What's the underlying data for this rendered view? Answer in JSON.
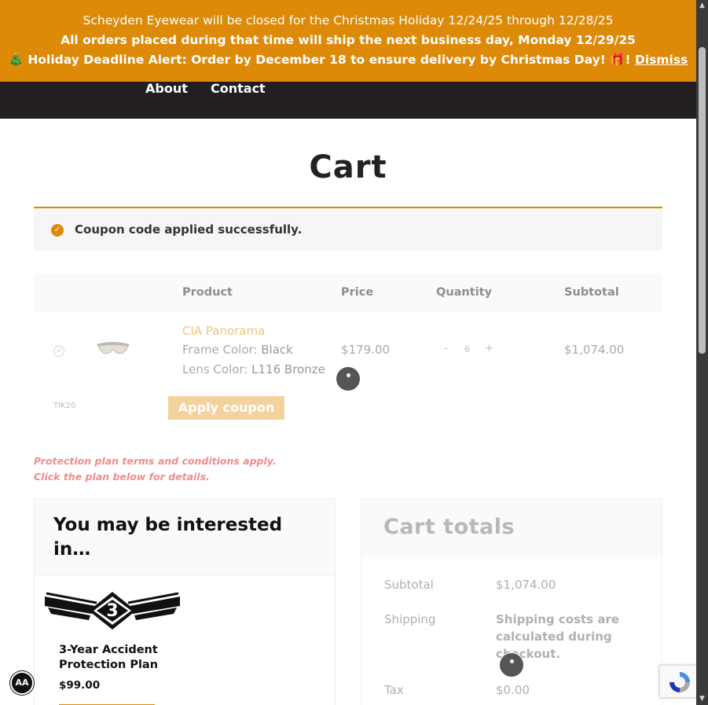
{
  "banner": {
    "line1": "Scheyden Eyewear will be closed for the Christmas Holiday 12/24/25 through 12/28/25",
    "line2": "All orders placed during that time will ship the next business day, Monday 12/29/25",
    "line3": "🎄 Holiday Deadline Alert: Order by December 18 to ensure delivery by Christmas Day! 🎁!",
    "dismiss": "Dismiss",
    "color": "#dd8a08"
  },
  "nav": {
    "items": [
      {
        "label": "About"
      },
      {
        "label": "Contact"
      }
    ],
    "background": "#231f20"
  },
  "page_title": "Cart",
  "notice": {
    "icon": "check-circle-icon",
    "message": "Coupon code applied successfully."
  },
  "cart": {
    "headers": {
      "product": "Product",
      "price": "Price",
      "quantity": "Quantity",
      "subtotal": "Subtotal"
    },
    "items": [
      {
        "name": "CIA Panorama",
        "attributes": [
          {
            "label": "Frame Color:",
            "value": "Black"
          },
          {
            "label": "Lens Color:",
            "value": "L116 Bronze"
          }
        ],
        "price": "$179.00",
        "quantity": {
          "minus": "-",
          "value": "6",
          "plus": "+"
        },
        "subtotal": "$1,074.00"
      }
    ],
    "coupon": {
      "value": "TIK20",
      "button": "Apply coupon"
    }
  },
  "plan_note": {
    "line1": "Protection plan terms and conditions apply.",
    "line2": "Click the plan below for details."
  },
  "interested": {
    "title": "You may be interested in…",
    "badge_number": "3",
    "product": {
      "name": "3-Year Accident Protection Plan",
      "price": "$99.00"
    }
  },
  "totals": {
    "title": "Cart totals",
    "subtotal_label": "Subtotal",
    "subtotal_value": "$1,074.00",
    "shipping_label": "Shipping",
    "shipping_value": "Shipping costs are calculated during checkout.",
    "tax_label": "Tax",
    "tax_value": "$0.00"
  },
  "accessibility": {
    "label": "AA"
  }
}
